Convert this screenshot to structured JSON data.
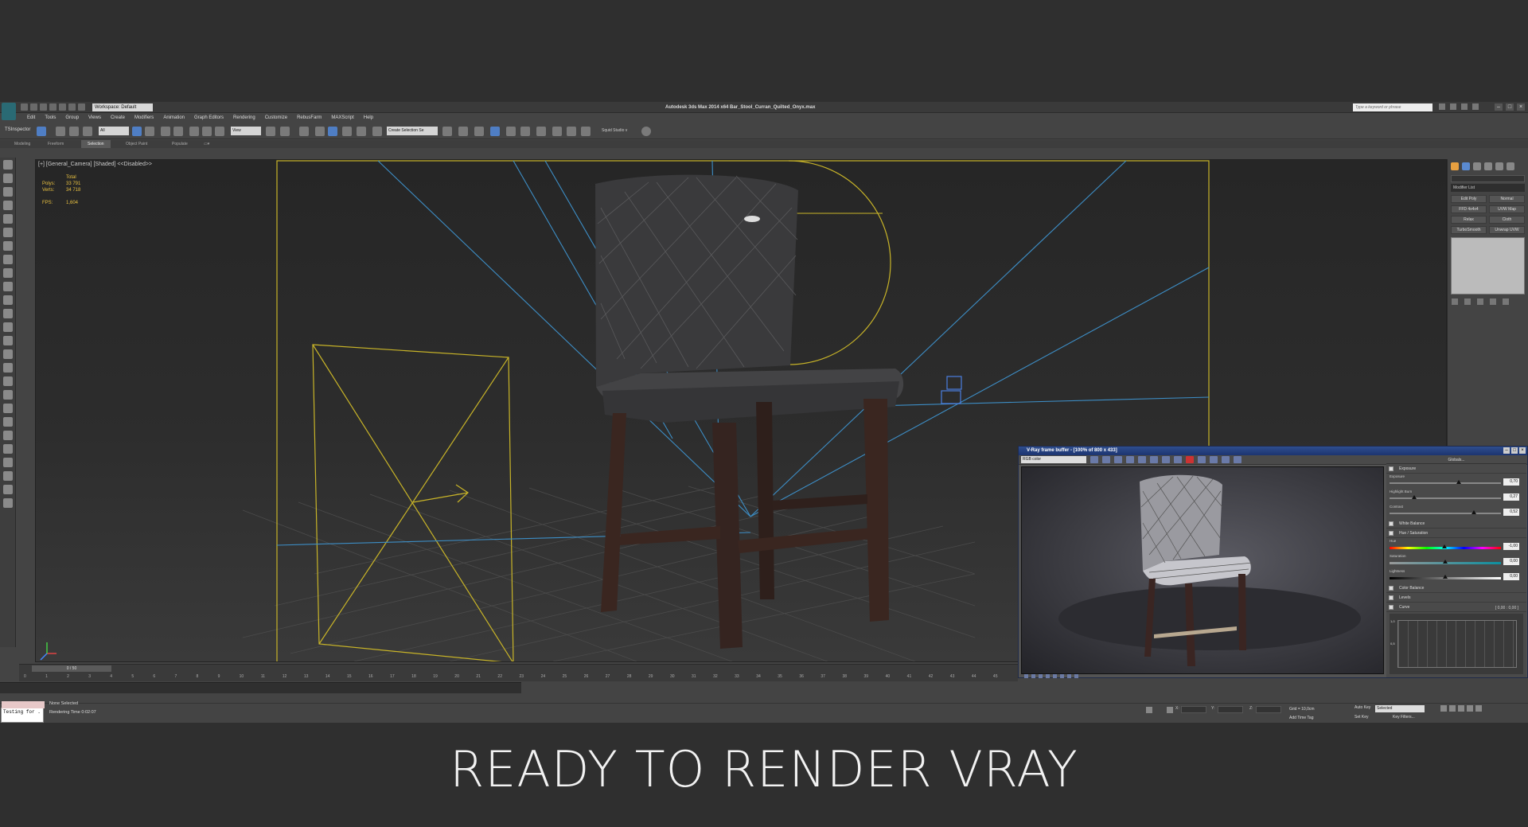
{
  "app": {
    "title": "Autodesk 3ds Max  2014 x64    Bar_Stool_Curran_Quilted_Onyx.max",
    "workspace": "Workspace: Default",
    "search_placeholder": "Type a keyword or phrase"
  },
  "menu": [
    "Edit",
    "Tools",
    "Group",
    "Views",
    "Create",
    "Modifiers",
    "Animation",
    "Graph Editors",
    "Rendering",
    "Customize",
    "RebusFarm",
    "MAXScript",
    "Help"
  ],
  "toolbar": {
    "tsinspector": "TSInspector",
    "filter": "All",
    "refcoord": "View",
    "selection_set": "Create Selection Se",
    "squid": "Squid Studio v"
  },
  "ribbon": {
    "tabs": [
      "Modeling",
      "Freeform",
      "Selection",
      "Object Paint",
      "Populate"
    ],
    "active": "Selection"
  },
  "viewport": {
    "label": "[+] [General_Camera] [Shaded]  <<Disabled>>",
    "stats": {
      "total_label": "Total",
      "polys_label": "Polys:",
      "polys": "33 791",
      "verts_label": "Verts:",
      "verts": "34 718",
      "fps_label": "FPS:",
      "fps": "1,604"
    }
  },
  "command_panel": {
    "modifier_list": "Modifier List",
    "buttons": [
      "Edit Poly",
      "Normal",
      "FFD 4x4x4",
      "UVW Map",
      "Relax",
      "Cloth",
      "TurboSmooth",
      "Unwrap UVW"
    ]
  },
  "vfb": {
    "title": "V-Ray frame buffer - [100% of 800 x 433]",
    "channel": "RGB color",
    "globals": "Globals...",
    "sections": {
      "exposure": "Exposure",
      "white_balance": "White Balance",
      "hue_saturation": "Hue / Saturation",
      "color_balance": "Color Balance",
      "levels": "Levels",
      "curve": "Curve"
    },
    "params": {
      "exposure_label": "Exposure",
      "exposure": "0,70",
      "exposure_frac": 0.62,
      "highlight_label": "Highlight Burn",
      "highlight": "0,27",
      "highlight_frac": 0.22,
      "contrast_label": "Contrast",
      "contrast": "0,52",
      "contrast_frac": 0.76,
      "hue_label": "Hue",
      "hue": "-1,00",
      "hue_frac": 0.49,
      "saturation_label": "Saturation",
      "saturation": "0,00",
      "saturation_frac": 0.5,
      "lightness_label": "Lightness",
      "lightness": "0,00",
      "lightness_frac": 0.5
    },
    "curve_value": "[ 0,00 : 0,00 ]",
    "curve_tick_1": "1,0",
    "curve_tick_2": "0,5"
  },
  "timeline": {
    "slider": "0 / 50",
    "ticks": [
      "0",
      "1",
      "2",
      "3",
      "4",
      "5",
      "6",
      "7",
      "8",
      "9",
      "10",
      "11",
      "12",
      "13",
      "14",
      "15",
      "16",
      "17",
      "18",
      "19",
      "20",
      "21",
      "22",
      "23",
      "24",
      "25",
      "26",
      "27",
      "28",
      "29",
      "30",
      "31",
      "32",
      "33",
      "34",
      "35",
      "36",
      "37",
      "38",
      "39",
      "40",
      "41",
      "42",
      "43",
      "44",
      "45"
    ]
  },
  "status": {
    "maxscript": "Testing for .",
    "selection": "None Selected",
    "rendering_time": "Rendering Time  0:02:07",
    "x_label": "X:",
    "y_label": "Y:",
    "z_label": "Z:",
    "grid": "Grid = 10,0cm",
    "add_time_tag": "Add Time Tag",
    "auto_key": "Auto Key",
    "set_key": "Set Key",
    "selected": "Selected",
    "key_filters": "Key Filters..."
  },
  "caption": "READY TO RENDER  VRAY",
  "colors": {
    "viewport_bg": "#2a2a2a",
    "helper_yellow": "#c8b428",
    "camera_line_blue": "#4aa0d8",
    "vfb_title": "#2e4d8e"
  }
}
